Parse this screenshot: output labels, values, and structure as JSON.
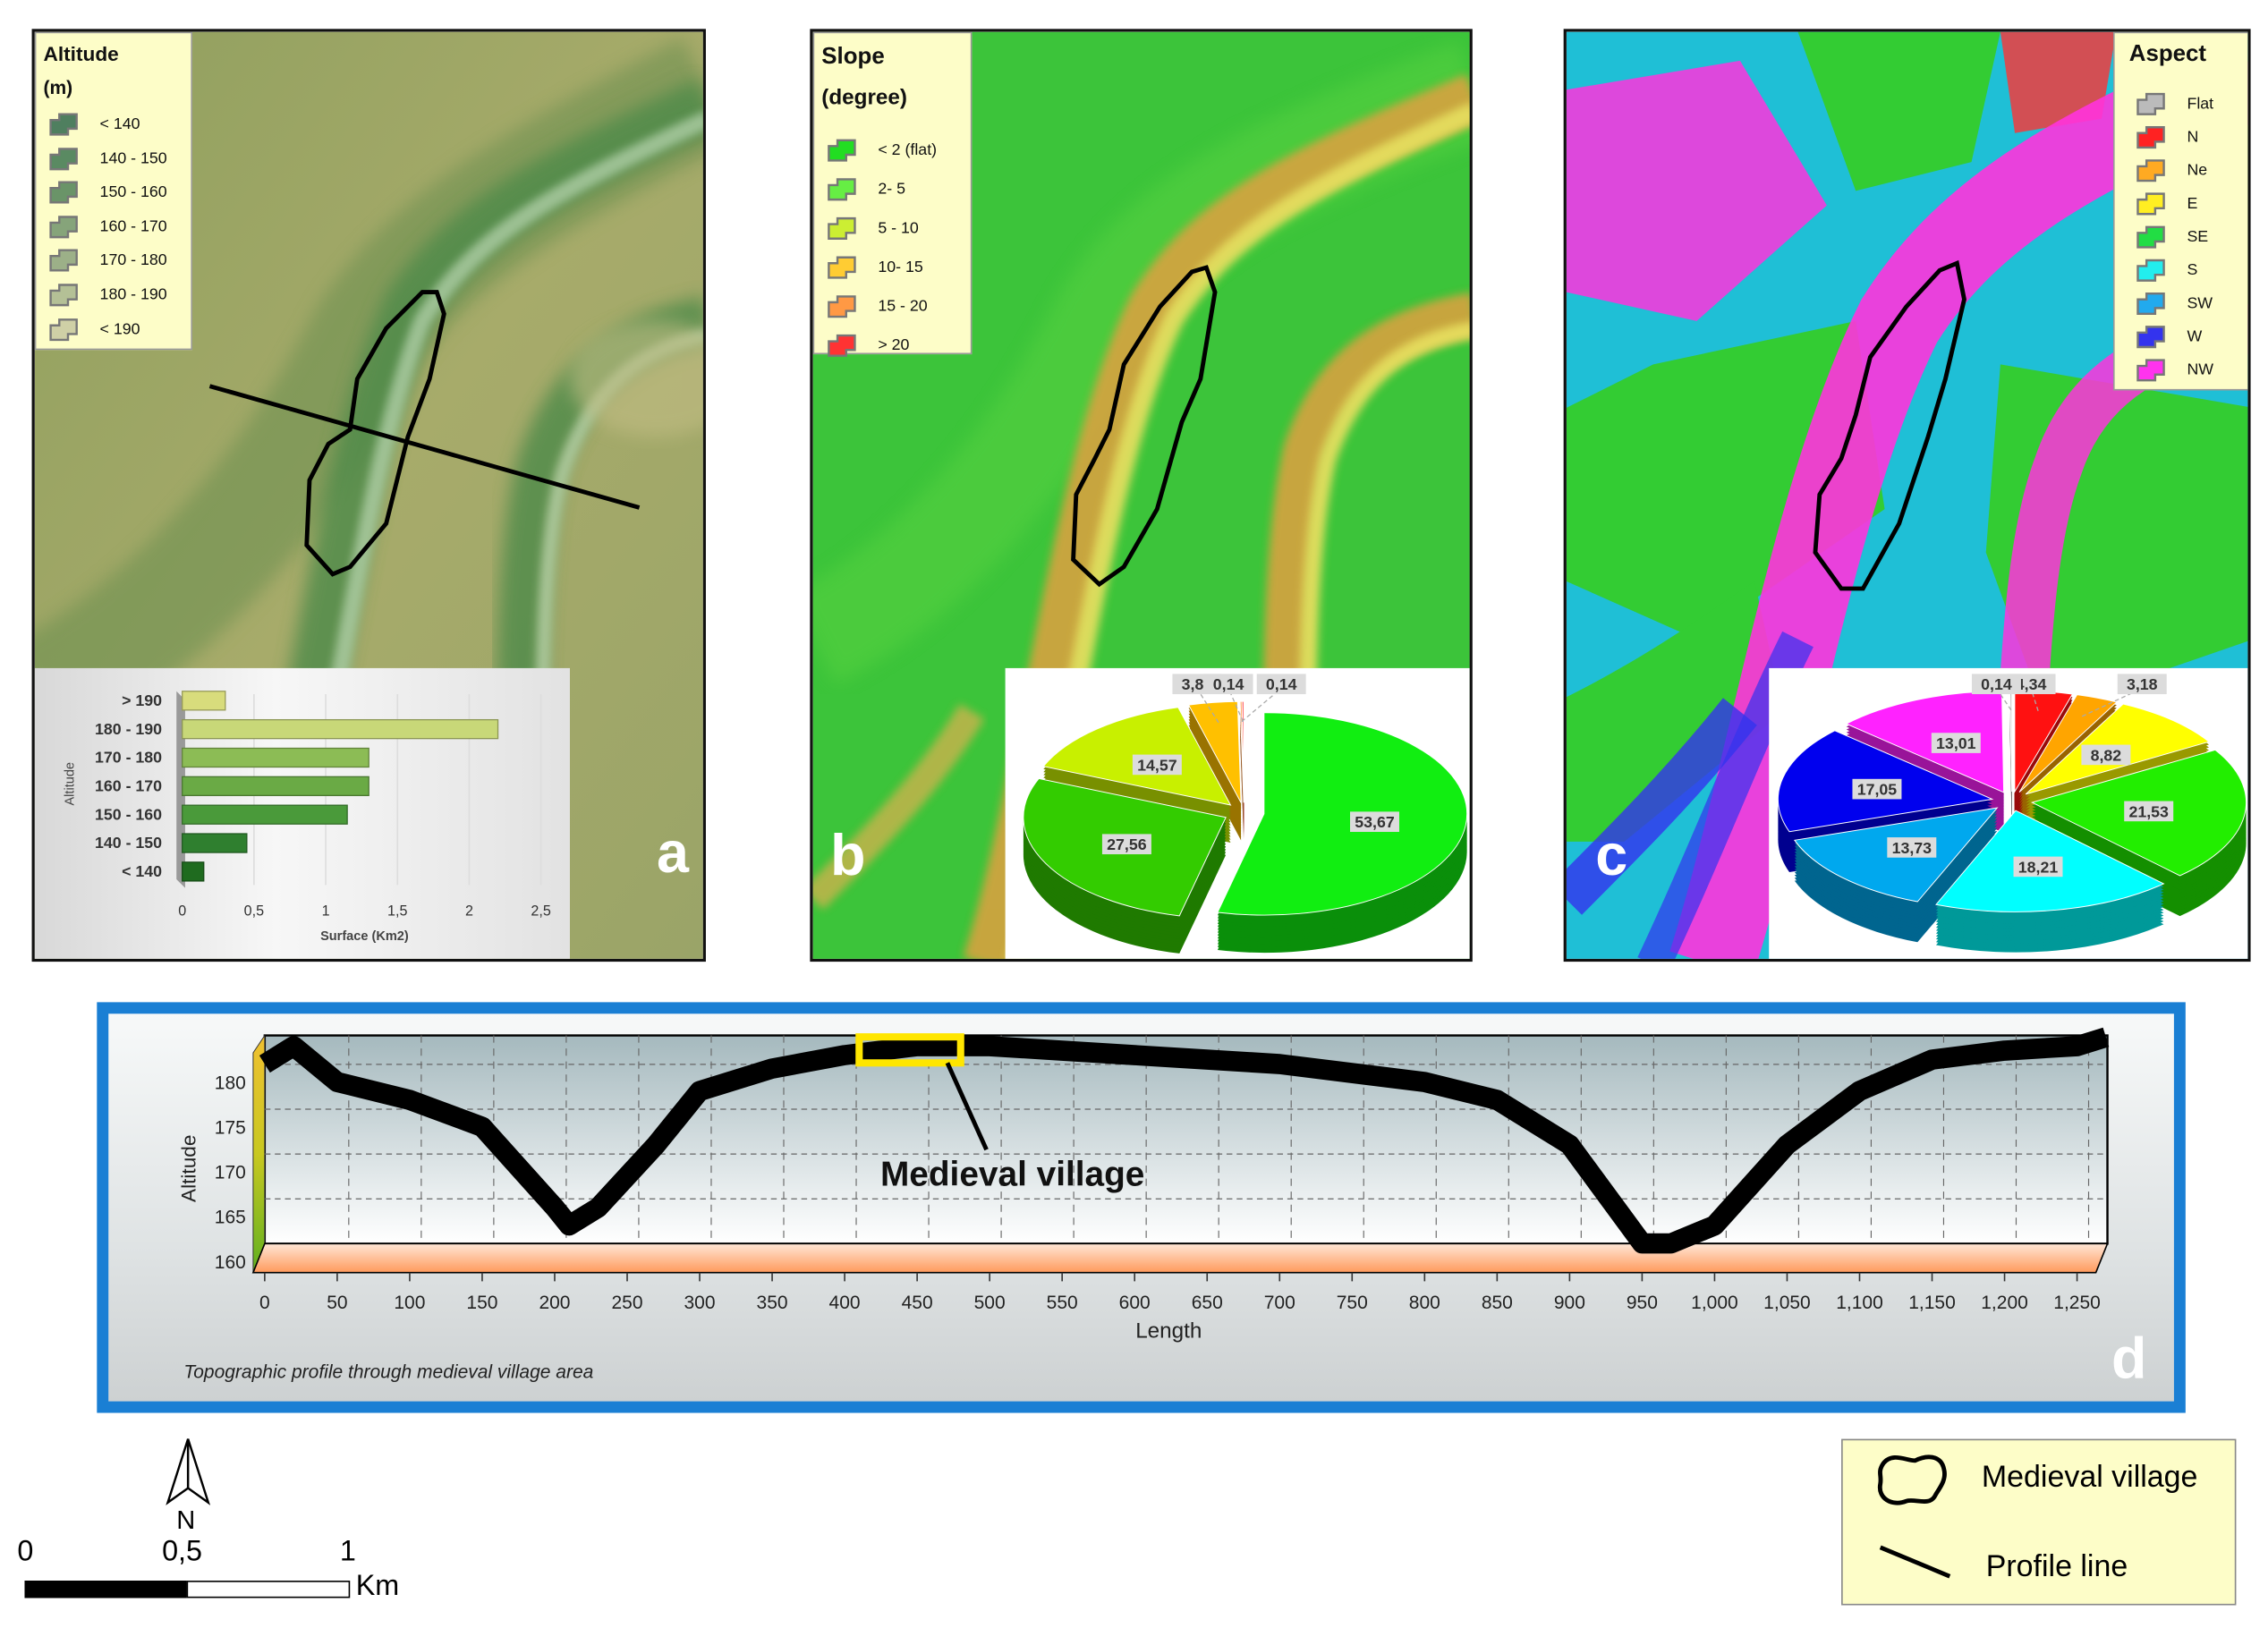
{
  "panels": {
    "a": {
      "letter": "a",
      "legend": {
        "title": "Altitude",
        "unit": "(m)",
        "items": [
          {
            "label": "< 140",
            "color": "#4f7f5f"
          },
          {
            "label": "140 - 150",
            "color": "#5a8a62"
          },
          {
            "label": "150 - 160",
            "color": "#6a9468"
          },
          {
            "label": "160 - 170",
            "color": "#86a47a"
          },
          {
            "label": "170 - 180",
            "color": "#9cb088"
          },
          {
            "label": "180 - 190",
            "color": "#b4c096"
          },
          {
            "label": "< 190",
            "color": "#cfd0a6"
          }
        ]
      }
    },
    "b": {
      "letter": "b",
      "legend": {
        "title": "Slope",
        "unit": "(degree)",
        "items": [
          {
            "label": "< 2 (flat)",
            "color": "#22dd22"
          },
          {
            "label": "2- 5",
            "color": "#66ee44"
          },
          {
            "label": "5 - 10",
            "color": "#ccee33"
          },
          {
            "label": "10- 15",
            "color": "#ffcc33"
          },
          {
            "label": "15 - 20",
            "color": "#ff9944"
          },
          {
            "label": "> 20",
            "color": "#ff3333"
          }
        ]
      }
    },
    "c": {
      "letter": "c",
      "legend": {
        "title": "Aspect",
        "items": [
          {
            "label": "Flat",
            "color": "#bbbbbb"
          },
          {
            "label": "N",
            "color": "#ff2222"
          },
          {
            "label": "Ne",
            "color": "#ffaa22"
          },
          {
            "label": "E",
            "color": "#ffee22"
          },
          {
            "label": "SE",
            "color": "#22dd44"
          },
          {
            "label": "S",
            "color": "#22eeee"
          },
          {
            "label": "SW",
            "color": "#22aaee"
          },
          {
            "label": "W",
            "color": "#3333ee"
          },
          {
            "label": "NW",
            "color": "#ff33ee"
          }
        ]
      }
    },
    "d": {
      "letter": "d"
    }
  },
  "chart_data": [
    {
      "type": "bar",
      "orientation": "horizontal",
      "categories": [
        "> 190",
        "180 - 190",
        "170 - 180",
        "160 - 170",
        "150 - 160",
        "140 - 150",
        "< 140"
      ],
      "values": [
        0.3,
        2.2,
        1.3,
        1.3,
        1.15,
        0.45,
        0.15
      ],
      "colors": [
        "#d8dc7c",
        "#c8d878",
        "#8cbc55",
        "#6aaa45",
        "#4a9a3a",
        "#2f7f2f",
        "#1f6b1f"
      ],
      "xticks": [
        "0",
        "0,5",
        "1",
        "1,5",
        "2",
        "2,5"
      ],
      "xlim": [
        0,
        2.5
      ],
      "xlabel": "Surface (Km2)",
      "ylabel": "Altitude",
      "title": ""
    },
    {
      "type": "pie",
      "title": "Slope",
      "categories": [
        "< 2 (flat)",
        "2- 5",
        "5 - 10",
        "10- 15",
        "15 - 20",
        "> 20"
      ],
      "values": [
        53.67,
        27.56,
        14.57,
        3.89,
        0.14,
        0.14
      ],
      "labels": [
        "53,67",
        "27,56",
        "14,57",
        "3,89",
        "0,14",
        "0,14"
      ],
      "colors": [
        "#11ee11",
        "#33cc00",
        "#c8f000",
        "#ffc000",
        "#ff9944",
        "#ff3333"
      ]
    },
    {
      "type": "pie",
      "title": "Aspect",
      "categories": [
        "N",
        "Ne",
        "E",
        "SE",
        "S",
        "SW",
        "W",
        "NW",
        "Flat"
      ],
      "values": [
        4.34,
        3.18,
        8.82,
        21.53,
        18.21,
        13.73,
        17.05,
        13.01,
        0.14
      ],
      "labels": [
        "4,34",
        "3,18",
        "8,82",
        "21,53",
        "18,21",
        "13,73",
        "17,05",
        "13,01",
        "0,14"
      ],
      "colors": [
        "#ff1111",
        "#ffa500",
        "#ffff00",
        "#22ee00",
        "#00ffff",
        "#00a8ee",
        "#0000ee",
        "#ff22ff",
        "#bbbbbb"
      ]
    },
    {
      "type": "line",
      "title": "Topographic profile through medieval village area",
      "xlabel": "Length",
      "ylabel": "Altitude",
      "xlim": [
        0,
        1270
      ],
      "ylim": [
        160,
        184
      ],
      "xticks": [
        "0",
        "50",
        "100",
        "150",
        "200",
        "250",
        "300",
        "350",
        "400",
        "450",
        "500",
        "550",
        "600",
        "650",
        "700",
        "750",
        "800",
        "850",
        "900",
        "950",
        "1,000",
        "1,050",
        "1,100",
        "1,150",
        "1,200",
        "1,250"
      ],
      "yticks": [
        "160",
        "165",
        "170",
        "175",
        "180"
      ],
      "x": [
        0,
        20,
        50,
        100,
        150,
        200,
        210,
        230,
        270,
        300,
        350,
        400,
        450,
        500,
        550,
        600,
        700,
        800,
        850,
        900,
        950,
        970,
        1000,
        1050,
        1100,
        1150,
        1200,
        1250,
        1270
      ],
      "y": [
        181,
        183,
        179,
        177,
        174,
        165,
        163,
        165,
        172,
        178,
        180.5,
        182,
        183,
        183,
        182.5,
        182,
        181,
        179,
        177,
        172,
        161,
        161,
        163,
        172,
        178,
        181.5,
        182.5,
        183,
        184
      ],
      "annotation": {
        "text": "Medieval village",
        "x_range": [
          410,
          480
        ]
      }
    }
  ],
  "scale_bar": {
    "labels": [
      "0",
      "0,5",
      "1"
    ],
    "unit": "Km",
    "north": "N"
  },
  "map_legend": {
    "village": "Medieval village",
    "profile": "Profile line"
  }
}
